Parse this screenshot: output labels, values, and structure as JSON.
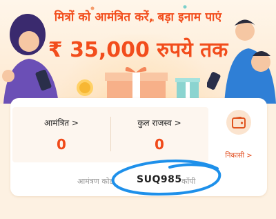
{
  "banner": {
    "headline": "मित्रों को आमंत्रित करें, बड़ा इनाम पाएं",
    "amount": "₹ 35,000 रुपये तक"
  },
  "stats": {
    "invited_label": "आमंत्रित >",
    "invited_value": "0",
    "revenue_label": "कुल राजस्व >",
    "revenue_value": "0"
  },
  "withdraw": {
    "label": "निकासी >",
    "icon": "wallet-icon"
  },
  "invite_code": {
    "prefix": "आमंत्रण कोड",
    "code": "SUQ985",
    "copy_label": "कॉपी"
  },
  "colors": {
    "accent": "#f24d1c",
    "background": "#fdf1e2",
    "annotation": "#1e90ea"
  }
}
